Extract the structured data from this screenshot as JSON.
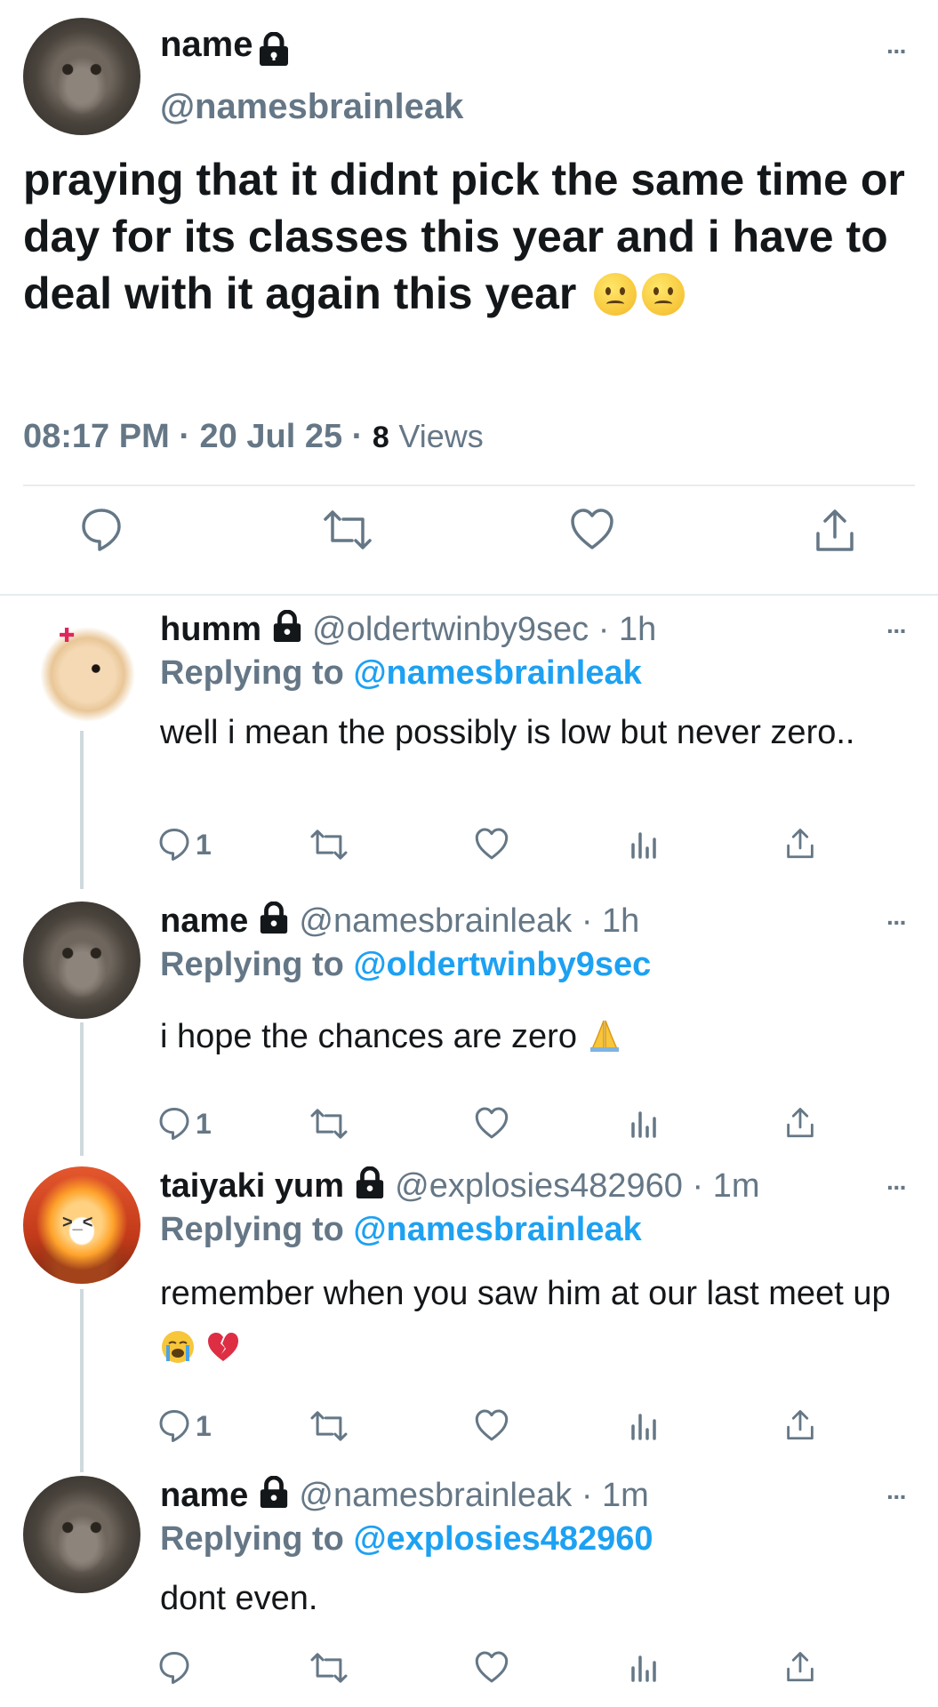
{
  "main_tweet": {
    "name": "name",
    "handle": "@namesbrainleak",
    "text": "praying that it didnt pick the same time or day for its classes this year and i have to deal with it again this year",
    "time": "08:17 PM",
    "dot": "·",
    "date": "20 Jul 25",
    "views_count": "8",
    "views_label": "Views",
    "more_label": "···"
  },
  "replies": [
    {
      "name": "humm",
      "handle": "@oldertwinby9sec",
      "age": "· 1h",
      "replying_prefix": "Replying to",
      "replying_to": "@namesbrainleak",
      "text": "well i mean the possibly is low but never zero..",
      "reply_count": "1",
      "avatar": "bunny-avatar"
    },
    {
      "name": "name",
      "handle": "@namesbrainleak",
      "age": "· 1h",
      "replying_prefix": "Replying to",
      "replying_to": "@oldertwinby9sec",
      "text": "i hope the chances are zero",
      "reply_count": "1",
      "avatar": "cat-avatar"
    },
    {
      "name": "taiyaki yum",
      "handle": "@explosies482960",
      "age": "· 1m",
      "replying_prefix": "Replying to",
      "replying_to": "@namesbrainleak",
      "text": "remember when you saw him at our last meet up",
      "reply_count": "1",
      "avatar": "explosion-avatar"
    },
    {
      "name": "name",
      "handle": "@namesbrainleak",
      "age": "· 1m",
      "replying_prefix": "Replying to",
      "replying_to": "@explosies482960",
      "text": "dont even.",
      "reply_count": "",
      "avatar": "cat-avatar"
    }
  ],
  "icons": {
    "reply": "reply-icon",
    "retweet": "retweet-icon",
    "like": "heart-icon",
    "views": "views-icon",
    "share": "share-icon",
    "lock": "lock-icon",
    "more": "more-icon"
  },
  "colors": {
    "link": "#1da1f2",
    "muted": "#657786",
    "text": "#14171a",
    "divider": "#e6ecf0"
  }
}
